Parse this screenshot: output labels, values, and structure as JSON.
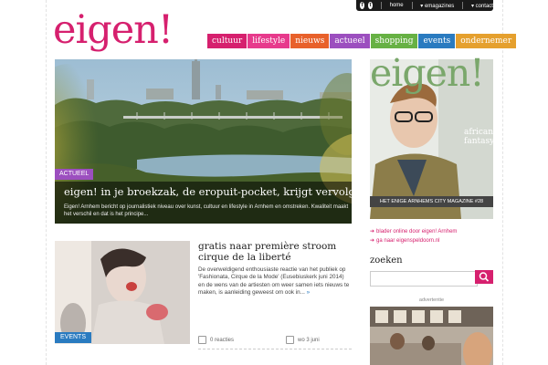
{
  "topbar": {
    "social": [
      "f",
      "t"
    ],
    "links": [
      "home",
      "emagazines",
      "contact"
    ]
  },
  "logo": "eigen!",
  "nav": [
    {
      "label": "cultuur",
      "color": "#d6206e"
    },
    {
      "label": "lifestyle",
      "color": "#e73a8c"
    },
    {
      "label": "nieuws",
      "color": "#e8612b"
    },
    {
      "label": "actueel",
      "color": "#9c4fbf"
    },
    {
      "label": "shopping",
      "color": "#67b144"
    },
    {
      "label": "events",
      "color": "#2a7bc0"
    },
    {
      "label": "ondernemer",
      "color": "#e5a02e"
    }
  ],
  "hero": {
    "tag": "ACTUEEL",
    "title": "eigen! in je broekzak, de eropuit-pocket, krijgt vervolg",
    "text": "Eigen! Arnhem bericht op journalistiek niveau over kunst, cultuur en lifestyle in Arnhem en omstreken. Kwaliteit maakt het verschil en dat is het principe..."
  },
  "article": {
    "tag": "EVENTS",
    "title": "gratis naar première stroom cirque de la liberté",
    "text": "De overweldigend enthousiaste reactie van het publiek op 'Fashionata, Cirque de la Mode' (Eusebiuskerk juni 2014) en de wens van de artiesten om weer samen iets nieuws te maken, is aanleiding geweest om ook in...",
    "more": "»",
    "comments": "0 reacties",
    "date": "wo 3 juni"
  },
  "sidebar": {
    "magazine_logo": "eigen!",
    "magazine_cover_text": "african fantasy",
    "magazine_strip": "HET ENIGE ARNHEMS CITY MAGAZINE #28",
    "links": [
      "blader online door eigen! Arnhem",
      "ga naar eigenspeldoorn.nl"
    ],
    "search_title": "zoeken",
    "search_placeholder": "",
    "advert_label": "advertentie"
  }
}
